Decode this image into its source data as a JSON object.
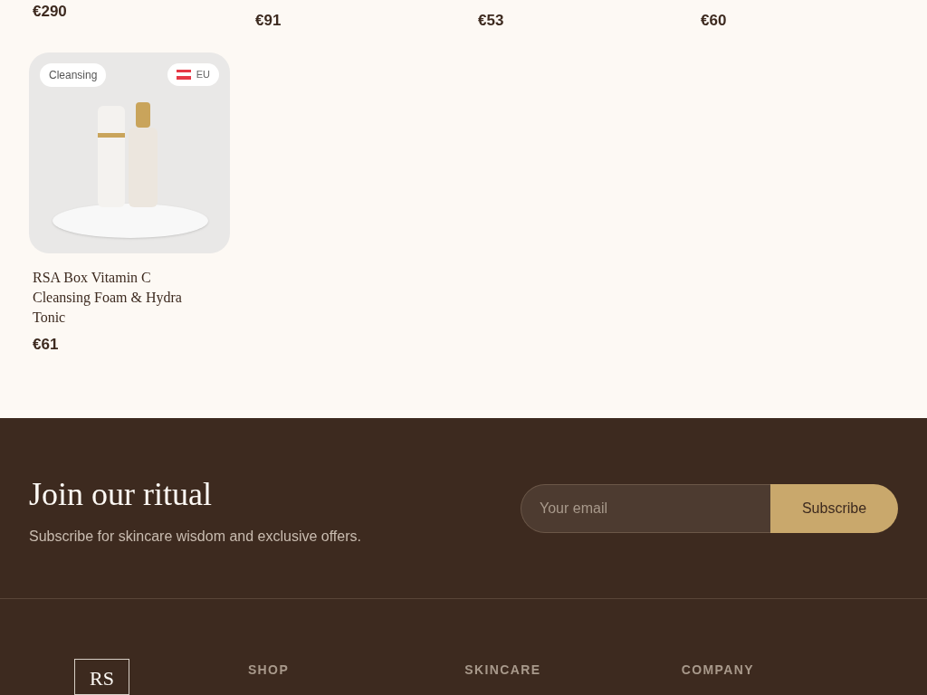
{
  "top_row_prices": [
    "€290",
    "€91",
    "€53",
    "€60"
  ],
  "product": {
    "category": "Cleansing",
    "region": "EU",
    "title": "RSA Box Vitamin C Cleansing Foam & Hydra Tonic",
    "price": "€61"
  },
  "newsletter": {
    "heading": "Join our ritual",
    "subtext": "Subscribe for skincare wisdom and exclusive offers.",
    "placeholder": "Your email",
    "button": "Subscribe"
  },
  "footer": {
    "logo_text": "RS",
    "columns": [
      "SHOP",
      "SKINCARE",
      "COMPANY"
    ]
  }
}
